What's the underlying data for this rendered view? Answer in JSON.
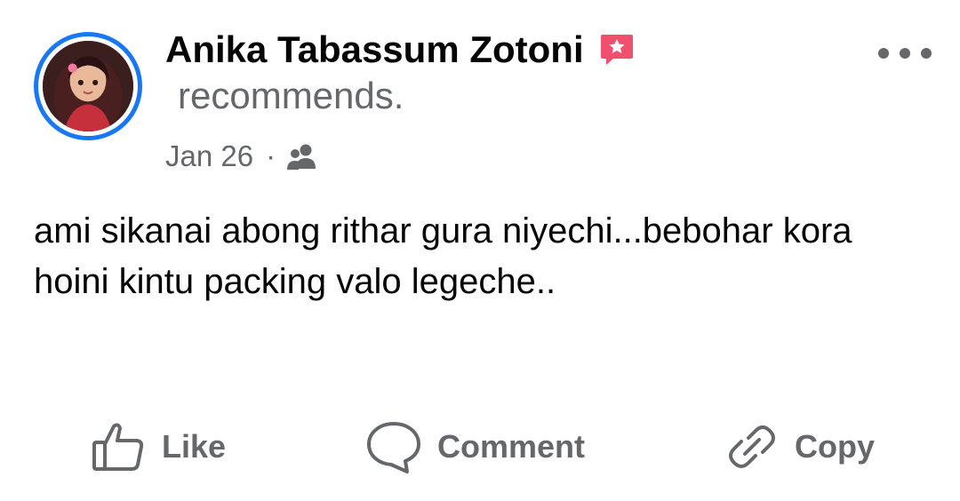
{
  "post": {
    "author": "Anika Tabassum Zotoni",
    "verb": "recommends",
    "end_mark": ".",
    "date": "Jan 26",
    "separator": "·",
    "text": "ami sikanai abong rithar gura niyechi...bebohar kora hoini kintu packing valo legeche.."
  },
  "actions": {
    "like": "Like",
    "comment": "Comment",
    "copy": "Copy"
  },
  "icons": {
    "badge": "recommendation-star-badge-icon",
    "audience": "friends-audience-icon",
    "more": "more-options-icon",
    "like": "thumbs-up-icon",
    "comment": "comment-bubble-icon",
    "copy": "link-icon"
  },
  "colors": {
    "accent": "#1877f2",
    "badge": "#f0506e",
    "secondary_text": "#65676b",
    "primary_text": "#050505"
  }
}
